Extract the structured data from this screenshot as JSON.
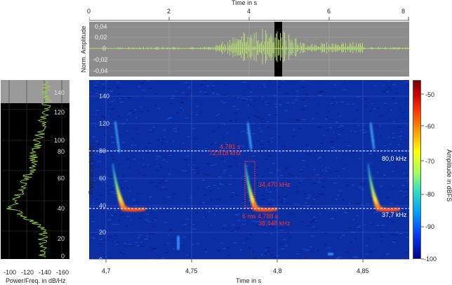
{
  "waveform": {
    "top_axis_title": "Time in s",
    "top_ticks": [
      "0",
      "2",
      "4",
      "6",
      "8"
    ],
    "ylabel": "Norm. Amplitude",
    "yticks": [
      "0,04",
      "0,02",
      "0",
      "-0,02",
      "-0,04"
    ]
  },
  "spectrum": {
    "xticks": [
      "-100",
      "-120",
      "-140",
      "-160"
    ],
    "xlabel": "Power/Freq. in dB/Hz"
  },
  "spectrogram": {
    "ylabel": "Frequency in kHz",
    "yticks": [
      "140",
      "120",
      "100",
      "80",
      "60",
      "40",
      "20",
      "0"
    ],
    "xticks": [
      "4,7",
      "4,75",
      "4,8",
      "4,85"
    ],
    "xlabel": "Time in s",
    "line_labels": [
      "80,0 kHz",
      "37,7 kHz"
    ],
    "annotations": {
      "top_time": "4,781 s",
      "top_freq": "72,918 kHz",
      "mid_freq": "34,470 kHz",
      "bottom": "6 ms  4,788 s",
      "bottom_freq": "38,448 kHz"
    }
  },
  "colorbar": {
    "label": "Amplitude in dBFS",
    "ticks": [
      "-50",
      "-60",
      "-70",
      "-80",
      "-90",
      "-100"
    ]
  },
  "colors": {
    "signal": "#9ad04a",
    "spectrogram_bg": "#0a2a9e",
    "annotation": "#ff3030",
    "panel_grey": "#8c8c8c"
  }
}
